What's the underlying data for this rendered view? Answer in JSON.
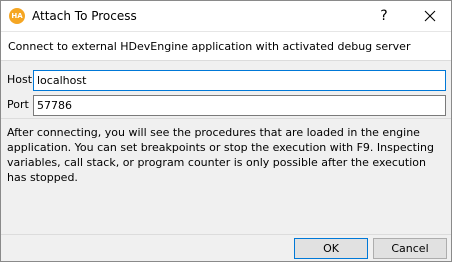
{
  "window": {
    "title": "Attach To Process",
    "app_icon_label": "HA",
    "help_glyph": "?"
  },
  "header": {
    "text": "Connect to external HDevEngine application with activated debug server"
  },
  "form": {
    "host_label": "Host",
    "host_value": "localhost",
    "port_label": "Port",
    "port_value": "57786"
  },
  "info": {
    "text": "After connecting, you will see the procedures that are loaded in the engine application. You can set breakpoints or stop the execution with F9. Inspecting variables, call stack, or program counter is only possible after the execution has stopped."
  },
  "buttons": {
    "ok_label": "OK",
    "cancel_label": "Cancel"
  },
  "colors": {
    "accent": "#0078d7",
    "icon": "#f5a623"
  },
  "icons": {
    "app": "halcon-app-icon",
    "close": "close-icon",
    "help": "help-icon"
  }
}
